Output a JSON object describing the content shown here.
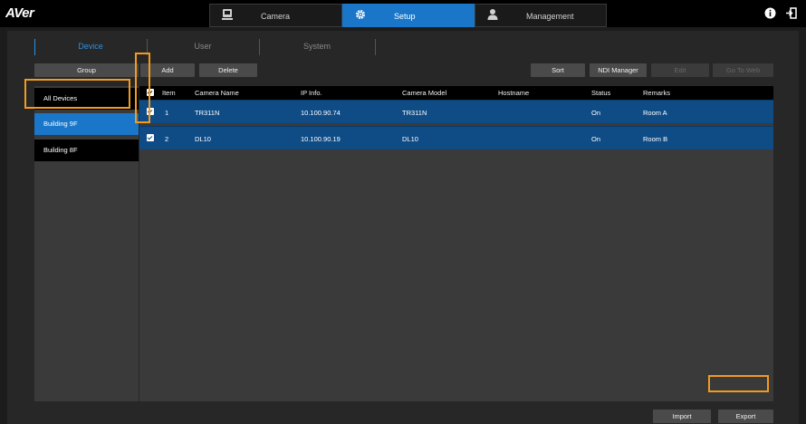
{
  "app": {
    "logo": "AVer"
  },
  "main_tabs": [
    {
      "label": "Camera",
      "icon": "camera-icon",
      "active": false
    },
    {
      "label": "Setup",
      "icon": "gear-icon",
      "active": true
    },
    {
      "label": "Management",
      "icon": "user-icon",
      "active": false
    }
  ],
  "top_right_icons": [
    "info-icon",
    "logout-icon"
  ],
  "sub_tabs": [
    {
      "label": "Device",
      "active": true
    },
    {
      "label": "User",
      "active": false
    },
    {
      "label": "System",
      "active": false
    }
  ],
  "toolbar": {
    "group": "Group",
    "add": "Add",
    "delete": "Delete",
    "sort": "Sort",
    "ndi_manager": "NDI Manager",
    "edit": "Edit",
    "go_to_web": "Go To Web"
  },
  "groups": [
    {
      "label": "All Devices",
      "selected": false
    },
    {
      "label": "Building 9F",
      "selected": true
    },
    {
      "label": "Building 8F",
      "selected": false
    }
  ],
  "table": {
    "columns": [
      "Item",
      "Camera Name",
      "IP Info.",
      "Camera Model",
      "Hostname",
      "Status",
      "Remarks"
    ],
    "rows": [
      {
        "item": "1",
        "name": "TR311N",
        "ip": "10.100.90.74",
        "model": "TR311N",
        "hostname": "",
        "status": "On",
        "remarks": "Room A",
        "checked": true
      },
      {
        "item": "2",
        "name": "DL10",
        "ip": "10.100.90.19",
        "model": "DL10",
        "hostname": "",
        "status": "On",
        "remarks": "Room B",
        "checked": true
      }
    ]
  },
  "footer": {
    "import": "Import",
    "export": "Export"
  },
  "colors": {
    "accent": "#1976c9",
    "row_selected": "#0f4c86",
    "highlight": "#f29b1e"
  }
}
